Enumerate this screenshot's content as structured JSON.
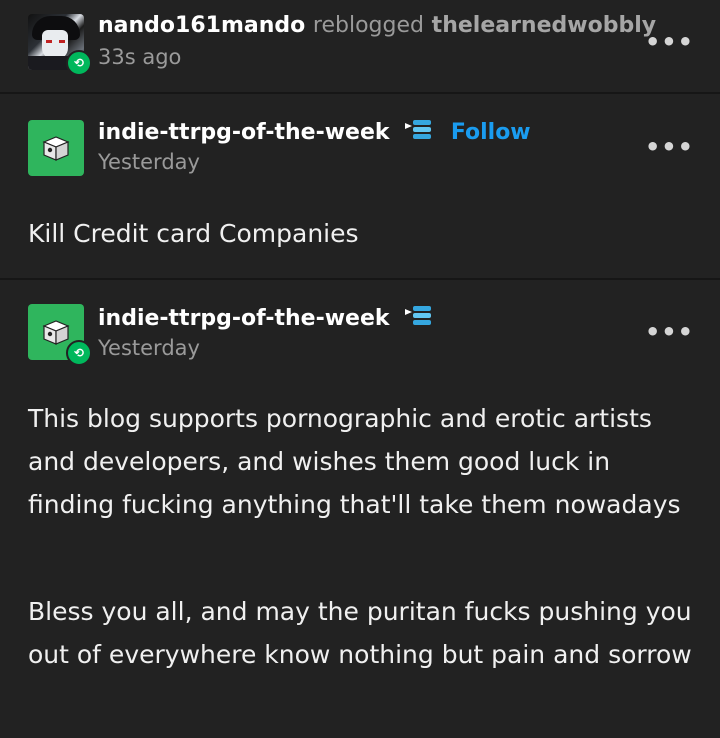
{
  "reblog": {
    "username": "nando161mando",
    "action": "reblogged",
    "source": "thelearnedwobbly",
    "time": "33s ago",
    "more_label": "•••"
  },
  "post1": {
    "blog_name": "indie-ttrpg-of-the-week",
    "follow_label": "Follow",
    "time": "Yesterday",
    "more_label": "•••",
    "body": "Kill Credit card Companies"
  },
  "post2": {
    "blog_name": "indie-ttrpg-of-the-week",
    "time": "Yesterday",
    "more_label": "•••",
    "paragraphs": [
      "This blog supports pornographic and erotic artists and developers, and wishes them good luck in finding fucking anything that'll take them nowadays",
      "Bless you all, and may the puritan fucks pushing you out of everywhere know nothing but pain and sorrow"
    ]
  },
  "colors": {
    "background": "#222222",
    "divider": "#161616",
    "follow": "#1a9cf0",
    "reblog_badge": "#00b85c",
    "blog_avatar": "#2fb55d",
    "muted_text": "#9a9a9a"
  },
  "icons": [
    "reblog-icon",
    "dice-icon",
    "verified-badge-icon",
    "more-options-icon"
  ]
}
